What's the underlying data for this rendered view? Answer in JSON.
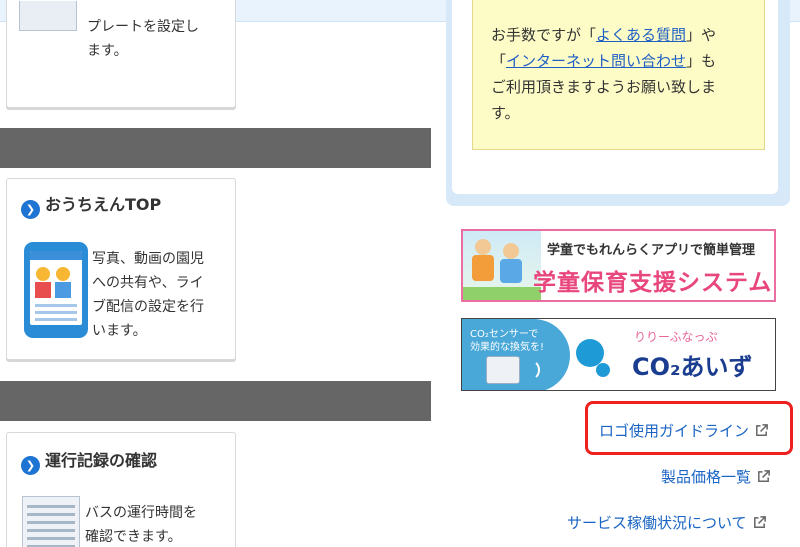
{
  "left": {
    "card_top": {
      "desc_line1": "プレートを設定し",
      "desc_line2": "ます。"
    },
    "card_ouchien": {
      "title": "おうちえんTOP",
      "desc_lines": [
        "写真、動画の園児",
        "への共有や、ライ",
        "ブ配信の設定を行",
        "います。"
      ]
    },
    "card_operation": {
      "title": "運行記録の確認",
      "desc_lines": [
        "バスの運行時間を",
        "確認できます。"
      ]
    }
  },
  "right": {
    "note": {
      "line1_prefix": "お手数ですが「",
      "link_faq": "よくある質問",
      "line1_suffix": "」や",
      "line2_prefix": "「",
      "link_inquiry": "インターネット問い合わせ",
      "line2_suffix": "」も",
      "line3": "ご利用頂きますようお願い致しま",
      "line4": "す。"
    },
    "banner_gakudo": {
      "headline": "学童でもれんらくアプリで簡単管理",
      "product": "学童保育支援システム"
    },
    "banner_co2": {
      "bubble_line1": "CO₂センサーで",
      "bubble_line2": "効果的な換気を!",
      "brand_small": "りりーふなっぷ",
      "brand_large": "CO₂あいず"
    },
    "links": {
      "logo_guideline": "ロゴ使用ガイドライン",
      "price_list": "製品価格一覧",
      "service_status": "サービス稼働状況について"
    }
  },
  "colors": {
    "link": "#1a64c4",
    "highlight": "#ee2020",
    "gray_bar": "#666666",
    "note_bg": "#fdfcc6"
  }
}
